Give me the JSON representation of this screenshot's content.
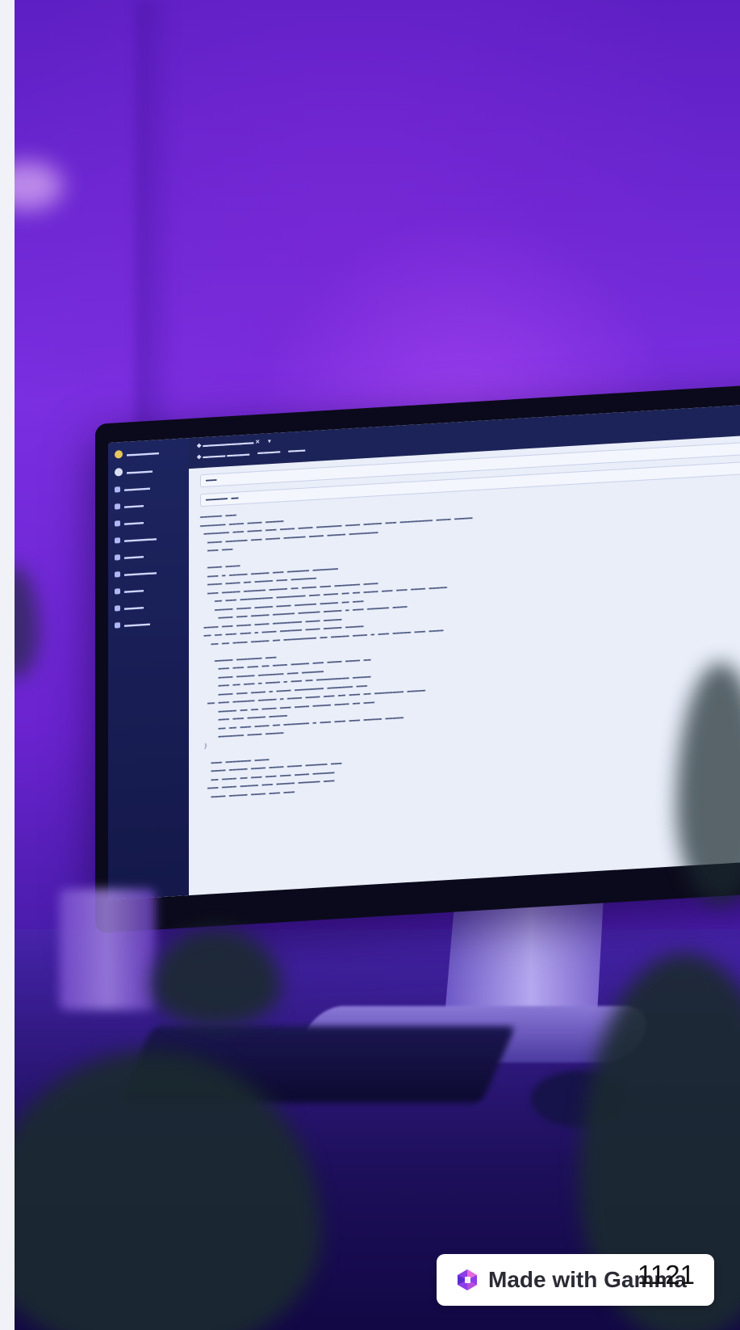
{
  "watermark": {
    "text": "Made with Gamma",
    "logo_icon": "gamma-logo-icon"
  },
  "page_number": "1121",
  "colors": {
    "background_purple": "#6a23cf",
    "screen": "#e9eef9",
    "sidebar": "#1d2560"
  }
}
